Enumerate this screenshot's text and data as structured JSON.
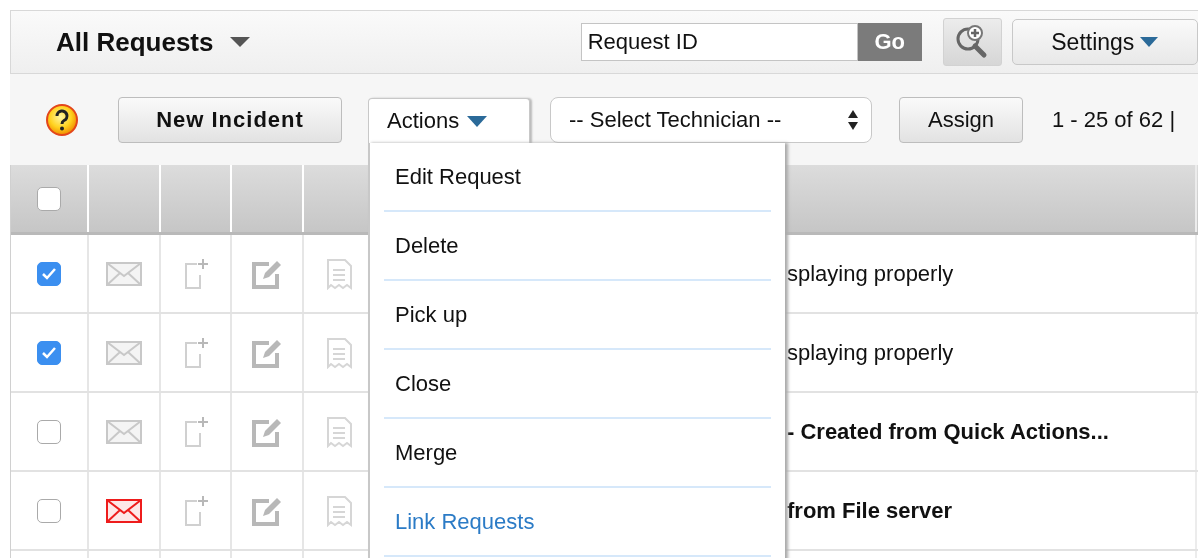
{
  "header": {
    "title": "All Requests",
    "search": {
      "value": "Request ID"
    },
    "go_button": "Go",
    "settings_button": "Settings"
  },
  "toolbar": {
    "new_button": "New Incident",
    "actions_button": "Actions",
    "actions_open": true,
    "technician_select": "-- Select Technician --",
    "assign_button": "Assign",
    "pagination": "1 - 25 of 62 |"
  },
  "actions_menu": [
    {
      "label": "Edit Request",
      "kind": "action"
    },
    {
      "label": "Delete",
      "kind": "action"
    },
    {
      "label": "Pick up",
      "kind": "action"
    },
    {
      "label": "Close",
      "kind": "action"
    },
    {
      "label": "Merge",
      "kind": "action"
    },
    {
      "label": "Link Requests",
      "kind": "link"
    }
  ],
  "table": {
    "header_checked": false,
    "rows": [
      {
        "checked": true,
        "mail_alert": false,
        "unread": false,
        "subject": "splaying properly"
      },
      {
        "checked": true,
        "mail_alert": false,
        "unread": false,
        "subject": "splaying properly"
      },
      {
        "checked": false,
        "mail_alert": false,
        "unread": true,
        "subject": "- Created from Quick Actions..."
      },
      {
        "checked": false,
        "mail_alert": true,
        "unread": true,
        "subject": "from File server"
      }
    ]
  }
}
